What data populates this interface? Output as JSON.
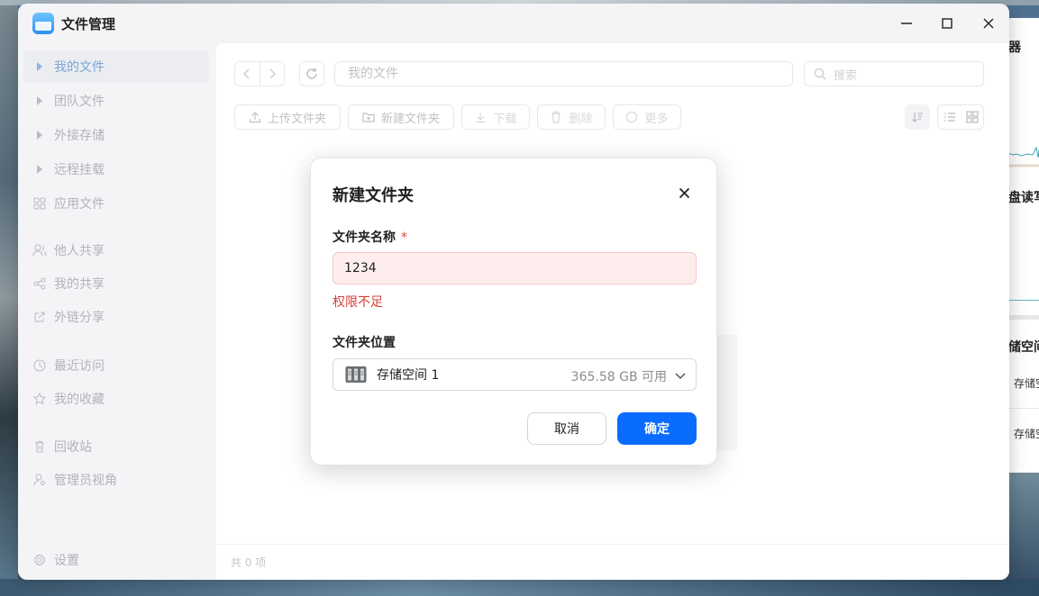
{
  "window": {
    "title": "文件管理"
  },
  "sidebar": {
    "items": [
      {
        "label": "我的文件",
        "active": true
      },
      {
        "label": "团队文件"
      },
      {
        "label": "外接存储"
      },
      {
        "label": "远程挂载"
      },
      {
        "label": "应用文件"
      },
      {
        "label": "他人共享"
      },
      {
        "label": "我的共享"
      },
      {
        "label": "外链分享"
      },
      {
        "label": "最近访问"
      },
      {
        "label": "我的收藏"
      },
      {
        "label": "回收站"
      },
      {
        "label": "管理员视角"
      }
    ],
    "settings_label": "设置"
  },
  "toolbar": {
    "path": "我的文件",
    "search_placeholder": "搜索",
    "upload_folder": "上传文件夹",
    "new_folder": "新建文件夹",
    "download": "下载",
    "delete": "删除",
    "more": "更多"
  },
  "footer": {
    "count": "共 0 项"
  },
  "dialog": {
    "title": "新建文件夹",
    "name_label": "文件夹名称",
    "required_mark": "*",
    "name_value": "1234",
    "error": "权限不足",
    "location_label": "文件夹位置",
    "location_name": "存储空间 1",
    "location_free": "365.58 GB 可用",
    "cancel": "取消",
    "confirm": "确定"
  },
  "background_window": {
    "frag1": "器",
    "frag2": "盘读写",
    "frag3": "储空间",
    "frag4": "存储空",
    "frag5": "存储空"
  },
  "colors": {
    "primary": "#0a6cff",
    "error": "#d64136",
    "error_bg": "#fdeeed",
    "sidebar_active": "#7aa6d8"
  }
}
